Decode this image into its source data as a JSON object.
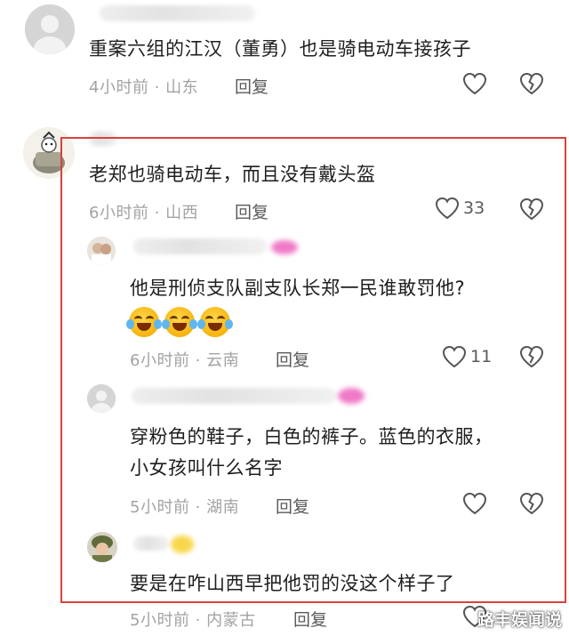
{
  "comments": [
    {
      "text": "重案六组的江汉（董勇）也是骑电动车接孩子",
      "time_location": "4小时前 · 山东",
      "reply_label": "回复",
      "likes": ""
    },
    {
      "text": "老郑也骑电动车，而且没有戴头盔",
      "time_location": "6小时前 · 山西",
      "reply_label": "回复",
      "likes": "33",
      "replies": [
        {
          "text": "他是刑侦支队副支队长郑一民谁敢罚他?",
          "time_location": "6小时前 · 云南",
          "reply_label": "回复",
          "likes": "11",
          "emoji": [
            "laugh-cry",
            "laugh-cry",
            "laugh-cry"
          ]
        },
        {
          "text_line1": "穿粉色的鞋子，白色的裤子。蓝色的衣服，",
          "text_line2": "小女孩叫什么名字",
          "time_location": "5小时前 · 湖南",
          "reply_label": "回复",
          "likes": ""
        },
        {
          "text": "要是在咋山西早把他罚的没这个样子了",
          "time_location": "5小时前 · 内蒙古",
          "reply_label": "回复",
          "likes": ""
        }
      ]
    }
  ],
  "watermark": "路丰娱闻说",
  "colors": {
    "highlight": "#d9413d",
    "meta_text": "#a3a3a3",
    "body_text": "#1e1e1e"
  },
  "icons": {
    "like": "heart-outline-icon",
    "dislike": "broken-heart-icon"
  }
}
